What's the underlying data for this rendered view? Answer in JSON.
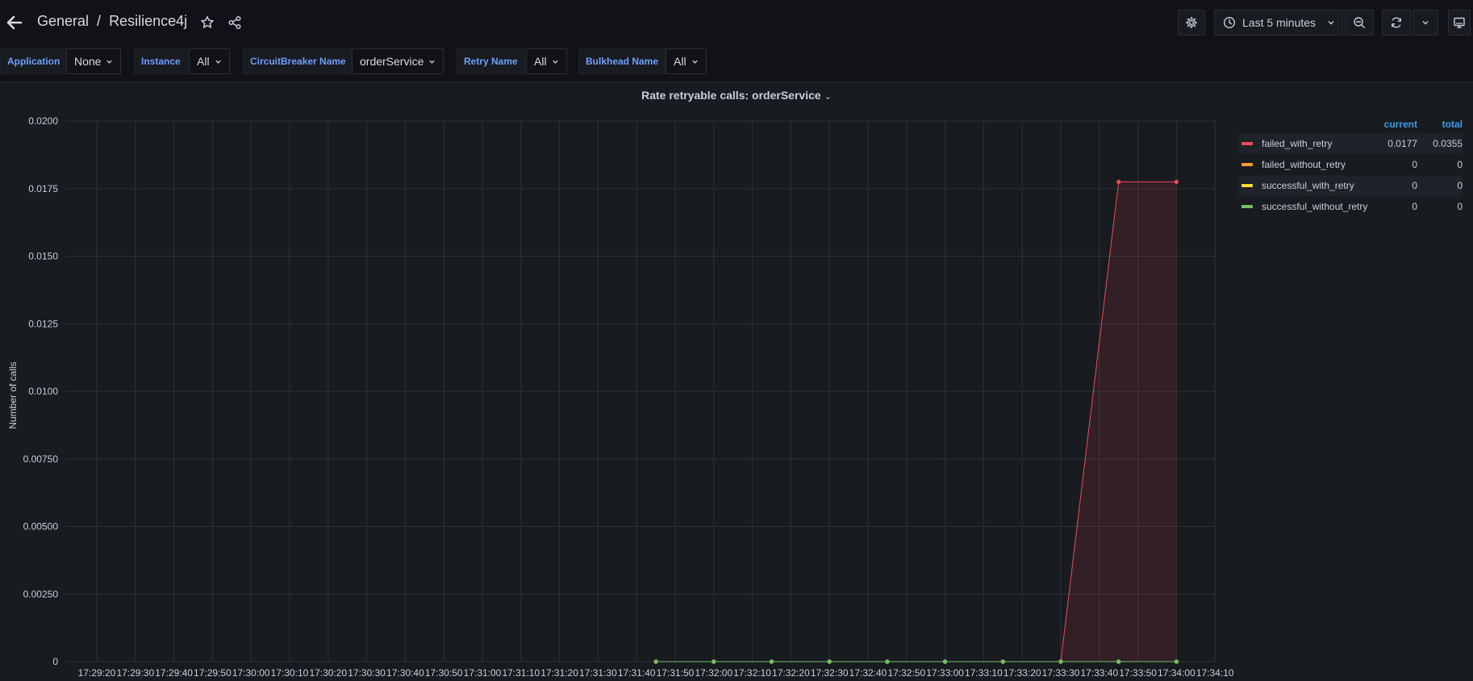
{
  "navbar": {
    "folder": "General",
    "separator": "/",
    "dashboard": "Resilience4j",
    "time_range": "Last 5 minutes"
  },
  "variables": [
    {
      "label": "Application",
      "value": "None"
    },
    {
      "label": "Instance",
      "value": "All"
    },
    {
      "label": "CircuitBreaker Name",
      "value": "orderService"
    },
    {
      "label": "Retry Name",
      "value": "All"
    },
    {
      "label": "Bulkhead Name",
      "value": "All"
    }
  ],
  "panel": {
    "title": "Rate retryable calls: orderService"
  },
  "legend": {
    "col_current": "current",
    "col_total": "total",
    "rows": [
      {
        "name": "failed_with_retry",
        "current": "0.0177",
        "total": "0.0355",
        "color": "#f2495c"
      },
      {
        "name": "failed_without_retry",
        "current": "0",
        "total": "0",
        "color": "#ff9830"
      },
      {
        "name": "successful_with_retry",
        "current": "0",
        "total": "0",
        "color": "#fade2a"
      },
      {
        "name": "successful_without_retry",
        "current": "0",
        "total": "0",
        "color": "#73bf69"
      }
    ]
  },
  "chart_data": {
    "type": "line",
    "title": "Rate retryable calls: orderService",
    "ylabel": "Number of calls",
    "xlabel": "",
    "ylim": [
      0,
      0.02
    ],
    "y_ticks": [
      "0",
      "0.00250",
      "0.00500",
      "0.00750",
      "0.0100",
      "0.0125",
      "0.0150",
      "0.0175",
      "0.0200"
    ],
    "x_ticks": [
      "17:29:20",
      "17:29:30",
      "17:29:40",
      "17:29:50",
      "17:30:00",
      "17:30:10",
      "17:30:20",
      "17:30:30",
      "17:30:40",
      "17:30:50",
      "17:31:00",
      "17:31:10",
      "17:31:20",
      "17:31:30",
      "17:31:40",
      "17:31:50",
      "17:32:00",
      "17:32:10",
      "17:32:20",
      "17:32:30",
      "17:32:40",
      "17:32:50",
      "17:33:00",
      "17:33:10",
      "17:33:20",
      "17:33:30",
      "17:33:40",
      "17:33:50",
      "17:34:00",
      "17:34:10"
    ],
    "grid": true,
    "legend_position": "right",
    "series": [
      {
        "name": "failed_with_retry",
        "color": "#f2495c",
        "fill": true,
        "x": [
          "17:31:45",
          "17:32:00",
          "17:32:15",
          "17:32:30",
          "17:32:45",
          "17:33:00",
          "17:33:15",
          "17:33:30",
          "17:33:45",
          "17:34:00"
        ],
        "values": [
          0,
          0,
          0,
          0,
          0,
          0,
          0,
          0,
          0.01775,
          0.01775
        ]
      },
      {
        "name": "failed_without_retry",
        "color": "#ff9830",
        "fill": false,
        "x": [
          "17:31:45",
          "17:32:00",
          "17:32:15",
          "17:32:30",
          "17:32:45",
          "17:33:00",
          "17:33:15",
          "17:33:30",
          "17:33:45",
          "17:34:00"
        ],
        "values": [
          0,
          0,
          0,
          0,
          0,
          0,
          0,
          0,
          0,
          0
        ]
      },
      {
        "name": "successful_with_retry",
        "color": "#fade2a",
        "fill": false,
        "x": [
          "17:31:45",
          "17:32:00",
          "17:32:15",
          "17:32:30",
          "17:32:45",
          "17:33:00",
          "17:33:15",
          "17:33:30",
          "17:33:45",
          "17:34:00"
        ],
        "values": [
          0,
          0,
          0,
          0,
          0,
          0,
          0,
          0,
          0,
          0
        ]
      },
      {
        "name": "successful_without_retry",
        "color": "#73bf69",
        "fill": false,
        "x": [
          "17:31:45",
          "17:32:00",
          "17:32:15",
          "17:32:30",
          "17:32:45",
          "17:33:00",
          "17:33:15",
          "17:33:30",
          "17:33:45",
          "17:34:00"
        ],
        "values": [
          0,
          0,
          0,
          0,
          0,
          0,
          0,
          0,
          0,
          0
        ]
      }
    ]
  }
}
